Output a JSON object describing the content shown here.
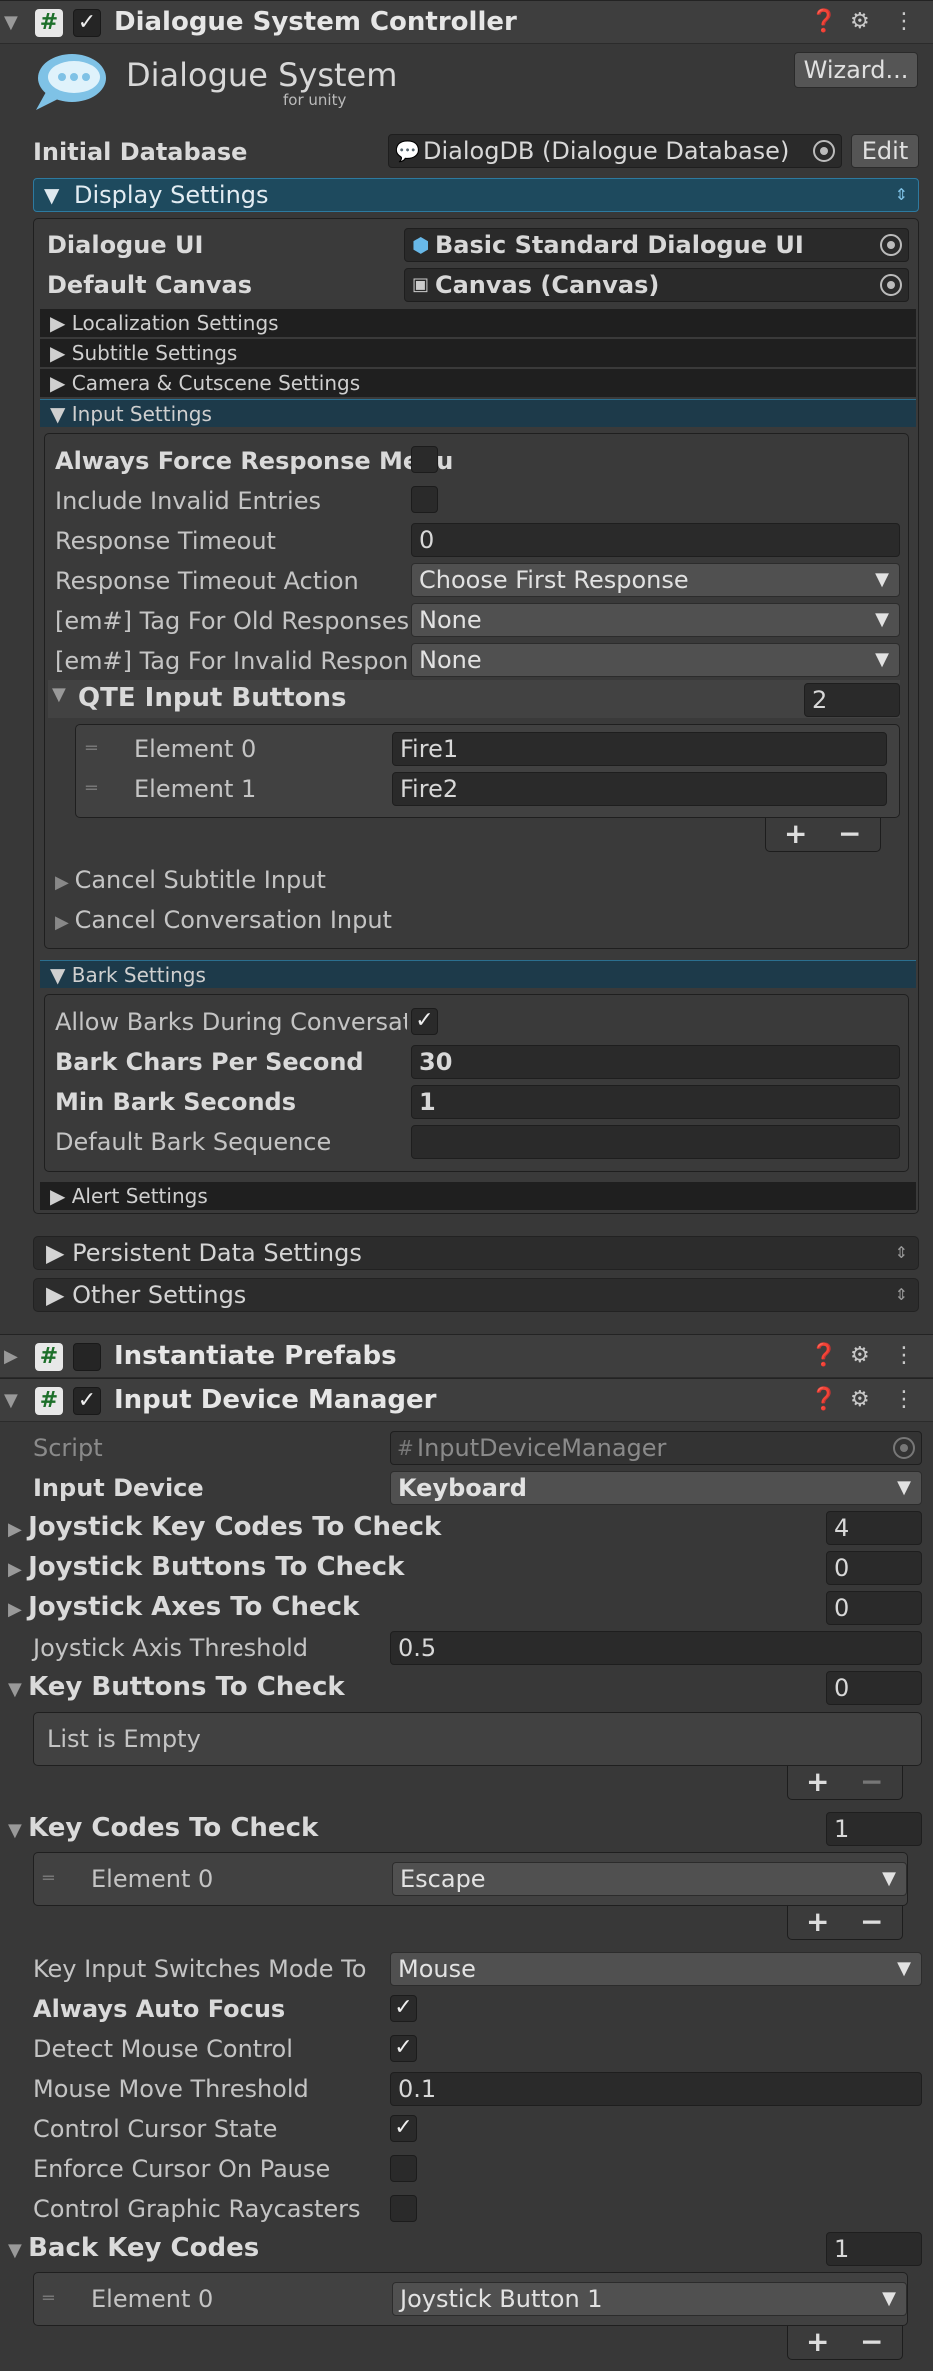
{
  "dsc": {
    "title": "Dialogue System Controller",
    "logo_title": "Dialogue System",
    "logo_sub": "for unity",
    "wizard": "Wizard...",
    "initial_db_label": "Initial Database",
    "initial_db_value": "DialogDB (Dialogue Database)",
    "edit": "Edit",
    "display_settings": "Display Settings",
    "dialogue_ui_label": "Dialogue UI",
    "dialogue_ui_value": "Basic Standard Dialogue UI",
    "default_canvas_label": "Default Canvas",
    "default_canvas_value": "Canvas (Canvas)",
    "localization": "Localization Settings",
    "subtitle": "Subtitle Settings",
    "camera": "Camera & Cutscene Settings",
    "input_settings": "Input Settings",
    "always_force": "Always Force Response Menu",
    "include_invalid": "Include Invalid Entries",
    "response_timeout": "Response Timeout",
    "response_timeout_value": "0",
    "response_timeout_action": "Response Timeout Action",
    "response_timeout_action_value": "Choose First Response",
    "tag_old": "[em#] Tag For Old Responses",
    "tag_old_value": "None",
    "tag_invalid": "[em#] Tag For Invalid Response",
    "tag_invalid_value": "None",
    "qte": "QTE Input Buttons",
    "qte_count": "2",
    "qte_elements": [
      {
        "label": "Element 0",
        "value": "Fire1"
      },
      {
        "label": "Element 1",
        "value": "Fire2"
      }
    ],
    "cancel_subtitle": "Cancel Subtitle Input",
    "cancel_conversation": "Cancel Conversation Input",
    "bark_settings": "Bark Settings",
    "allow_barks": "Allow Barks During Conversatio",
    "bark_cps": "Bark Chars Per Second",
    "bark_cps_value": "30",
    "min_bark": "Min Bark Seconds",
    "min_bark_value": "1",
    "default_bark_seq": "Default Bark Sequence",
    "default_bark_seq_value": "",
    "alert_settings": "Alert Settings",
    "persistent": "Persistent Data Settings",
    "other": "Other Settings"
  },
  "instantiate": {
    "title": "Instantiate Prefabs"
  },
  "idm": {
    "title": "Input Device Manager",
    "script_label": "Script",
    "script_value": "InputDeviceManager",
    "input_device_label": "Input Device",
    "input_device_value": "Keyboard",
    "joy_keycodes": "Joystick Key Codes To Check",
    "joy_keycodes_count": "4",
    "joy_buttons": "Joystick Buttons To Check",
    "joy_buttons_count": "0",
    "joy_axes": "Joystick Axes To Check",
    "joy_axes_count": "0",
    "joy_axis_threshold": "Joystick Axis Threshold",
    "joy_axis_threshold_value": "0.5",
    "key_buttons": "Key Buttons To Check",
    "key_buttons_count": "0",
    "list_empty": "List is Empty",
    "key_codes": "Key Codes To Check",
    "key_codes_count": "1",
    "key_codes_element_label": "Element 0",
    "key_codes_element_value": "Escape",
    "key_input_switches": "Key Input Switches Mode To",
    "key_input_switches_value": "Mouse",
    "always_auto_focus": "Always Auto Focus",
    "detect_mouse": "Detect Mouse Control",
    "mouse_move_threshold": "Mouse Move Threshold",
    "mouse_move_threshold_value": "0.1",
    "control_cursor": "Control Cursor State",
    "enforce_cursor": "Enforce Cursor On Pause",
    "control_graphic": "Control Graphic Raycasters",
    "back_key_codes": "Back Key Codes",
    "back_key_codes_count": "1",
    "back_element_label": "Element 0",
    "back_element_value": "Joystick Button 1"
  },
  "glyphs": {
    "plus": "+",
    "minus": "−",
    "check": "✓",
    "hash": "#",
    "fold_open": "▼",
    "fold_closed": "▶"
  }
}
